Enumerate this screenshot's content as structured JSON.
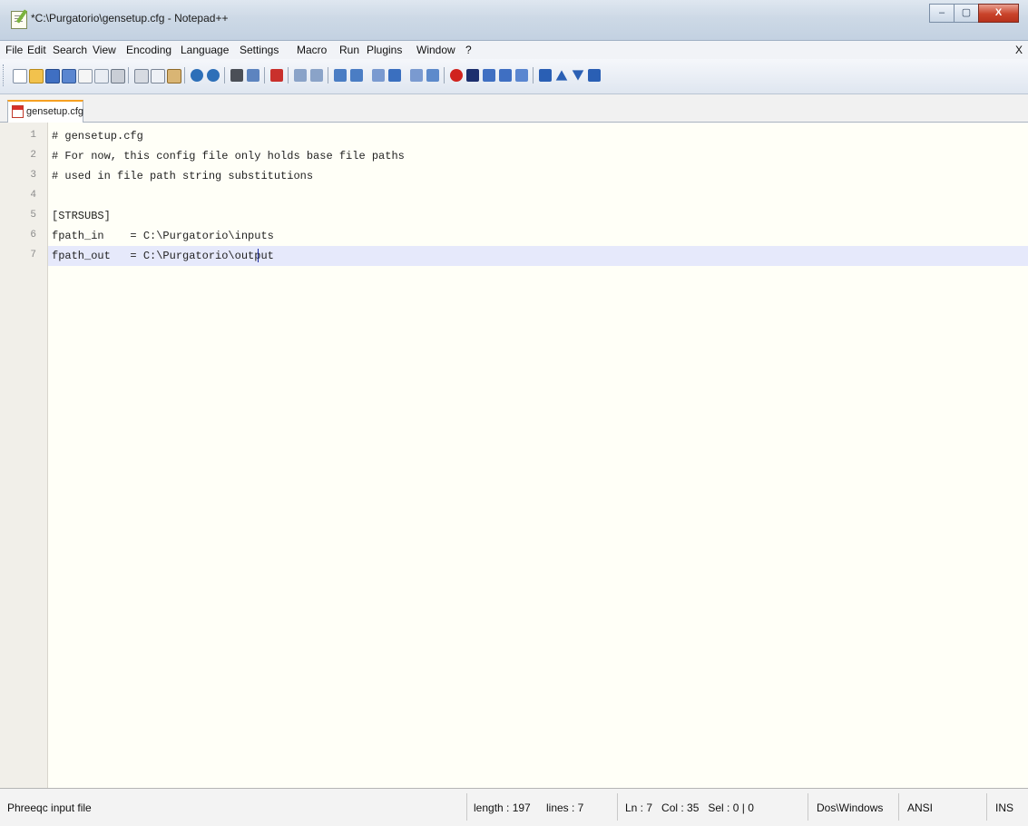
{
  "window": {
    "title": "*C:\\Purgatorio\\gensetup.cfg - Notepad++",
    "controls": {
      "minimize": "–",
      "maximize": "▢",
      "close": "X"
    }
  },
  "menu": {
    "items": [
      "File",
      "Edit",
      "Search",
      "View",
      "Encoding",
      "Language",
      "Settings",
      "Macro",
      "Run",
      "Plugins",
      "Window",
      "?"
    ],
    "close_label": "X"
  },
  "toolbar": {
    "icons": [
      "new-file-icon",
      "open-file-icon",
      "save-icon",
      "save-all-icon",
      "close-file-icon",
      "close-all-icon",
      "print-icon",
      "cut-icon",
      "copy-icon",
      "paste-icon",
      "undo-icon",
      "redo-icon",
      "find-icon",
      "replace-icon",
      "zoom-in-icon",
      "zoom-out-icon",
      "sync-vertical-icon",
      "sync-horizontal-icon",
      "word-wrap-icon",
      "show-all-chars-icon",
      "indent-guide-icon",
      "doc-map-icon",
      "record-macro-icon",
      "stop-macro-icon",
      "play-macro-icon",
      "run-macro-multiple-icon",
      "save-macro-icon",
      "sum-icon",
      "triangle-up-icon",
      "triangle-down-icon",
      "sum-alt-icon"
    ]
  },
  "tabs": [
    {
      "label": "gensetup.cfg",
      "active": true,
      "modified": true
    }
  ],
  "editor": {
    "lines": [
      {
        "num": "1",
        "text": "# gensetup.cfg"
      },
      {
        "num": "2",
        "text": "# For now, this config file only holds base file paths"
      },
      {
        "num": "3",
        "text": "# used in file path string substitutions"
      },
      {
        "num": "4",
        "text": ""
      },
      {
        "num": "5",
        "text": "[STRSUBS]"
      },
      {
        "num": "6",
        "text": "fpath_in    = C:\\Purgatorio\\inputs"
      },
      {
        "num": "7",
        "text": "fpath_out   = C:\\Purgatorio\\output"
      }
    ],
    "current_line": 7
  },
  "status": {
    "file_type": "Phreeqc input file",
    "length": "length : 197",
    "lines": "lines : 7",
    "position": "Ln : 7   Col : 35   Sel : 0 | 0",
    "eol": "Dos\\Windows",
    "encoding": "ANSI",
    "mode": "INS"
  },
  "colors": {
    "editor_bg": "#fffff7",
    "current_line_bg": "#e6e9fb",
    "tab_accent": "#f6a021",
    "caret": "#1b2a9d"
  }
}
